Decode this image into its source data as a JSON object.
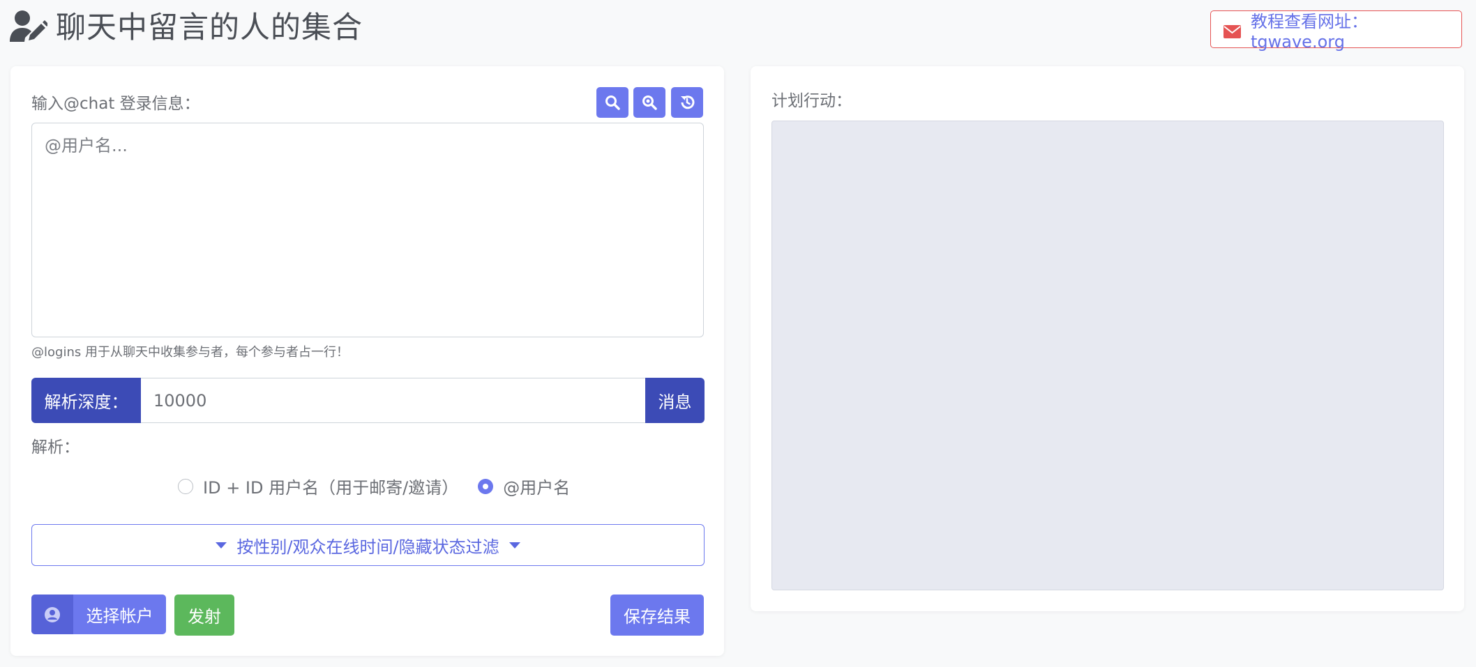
{
  "header": {
    "title": "聊天中留言的人的集合",
    "tutorial_link": "教程查看网址：tgwave.org"
  },
  "left_panel": {
    "input_label": "输入@chat 登录信息：",
    "textarea_placeholder": "@用户名...",
    "hint": "@logins 用于从聊天中收集参与者，每个参与者占一行！",
    "depth_prefix": "解析深度：",
    "depth_value": "10000",
    "depth_suffix": "消息",
    "parse_label": "解析：",
    "radio_options": [
      {
        "label": "ID + ID 用户名（用于邮寄/邀请）",
        "checked": false
      },
      {
        "label": "@用户名",
        "checked": true
      }
    ],
    "filter_button": "按性别/观众在线时间/隐藏状态过滤",
    "account_button": "选择帐户",
    "fire_button": "发射",
    "save_button": "保存结果"
  },
  "right_panel": {
    "plan_label": "计划行动："
  },
  "icons": [
    "user-edit-icon",
    "envelope-icon",
    "search-icon",
    "zoom-icon",
    "history-icon",
    "user-circle-icon",
    "caret-down-icon"
  ],
  "colors": {
    "accent": "#6c78ee",
    "dark_accent": "#3c4bb6",
    "success": "#5cb85c",
    "danger_border": "#e55353",
    "plan_bg": "#e7e9f1"
  }
}
